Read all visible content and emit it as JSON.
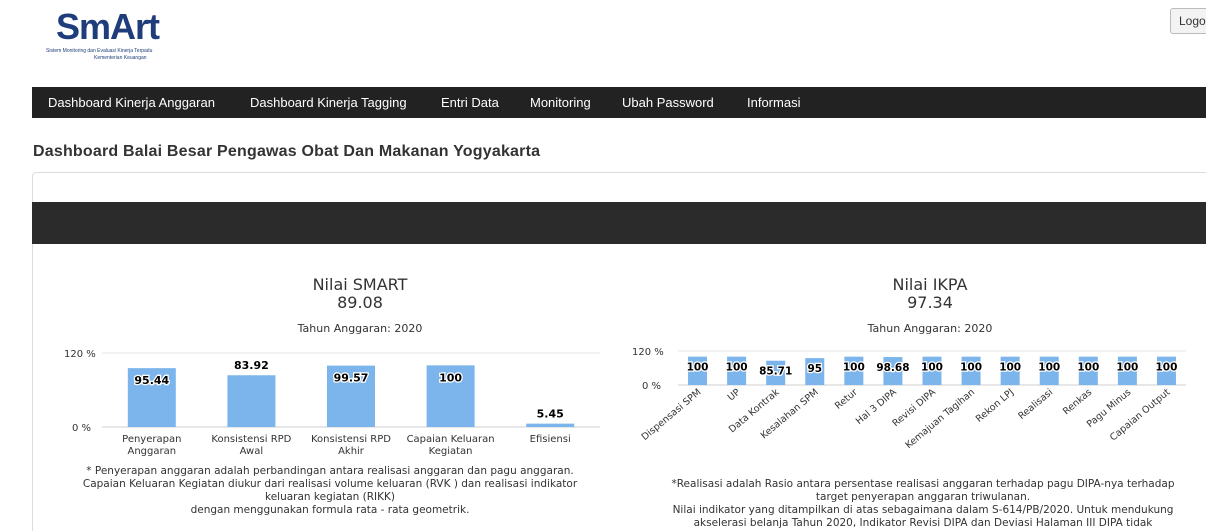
{
  "header": {
    "logo_text": "SmArt",
    "logo_tagline_1": "Sistem Monitoring dan Evaluasi Kinerja Terpadu",
    "logo_tagline_2": "Kementerian Keuangan",
    "logout_label": "Logo"
  },
  "nav": {
    "items": [
      "Dashboard Kinerja Anggaran",
      "Dashboard Kinerja Tagging",
      "Entri Data",
      "Monitoring",
      "Ubah Password",
      "Informasi"
    ]
  },
  "page_title": "Dashboard Balai Besar Pengawas Obat Dan Makanan Yogyakarta",
  "colors": {
    "bar": "#7cb5ec",
    "navbar": "#222222",
    "band": "#2b2b2b"
  },
  "chart_data": [
    {
      "type": "bar",
      "title": "Nilai SMART",
      "score": "89.08",
      "subtitle": "Tahun Anggaran: 2020",
      "categories": [
        [
          "Penyerapan",
          "Anggaran"
        ],
        [
          "Konsistensi RPD",
          "Awal"
        ],
        [
          "Konsistensi RPD",
          "Akhir"
        ],
        [
          "Capaian Keluaran",
          "Kegiatan"
        ],
        [
          "Efisiensi"
        ]
      ],
      "values": [
        95.44,
        83.92,
        99.57,
        100,
        5.45
      ],
      "value_labels": [
        "95.44",
        "83.92",
        "99.57",
        "100",
        "5.45"
      ],
      "y_ticks": [
        "120 %",
        "0 %"
      ],
      "ylim": [
        0,
        120
      ],
      "grid": true,
      "footnote": [
        "* Penyerapan anggaran adalah perbandingan antara realisasi anggaran dan pagu anggaran.",
        "Capaian Keluaran Kegiatan diukur dari realisasi volume keluaran (RVK ) dan realisasi indikator",
        "keluaran kegiatan (RIKK)",
        "dengan menggunakan formula rata - rata geometrik."
      ]
    },
    {
      "type": "bar",
      "title": "Nilai IKPA",
      "score": "97.34",
      "subtitle": "Tahun Anggaran: 2020",
      "categories": [
        "Dispensasi SPM",
        "UP",
        "Data Kontrak",
        "Kesalahan SPM",
        "Retur",
        "Hal 3 DIPA",
        "Revisi DIPA",
        "Kemajuan Tagihan",
        "Rekon LPJ",
        "Realisasi",
        "Renkas",
        "Pagu Minus",
        "Capaian Output"
      ],
      "values": [
        100,
        100,
        85.71,
        95,
        100,
        98.68,
        100,
        100,
        100,
        100,
        100,
        100,
        100
      ],
      "value_labels": [
        "100",
        "100",
        "85.71",
        "95",
        "100",
        "98.68",
        "100",
        "100",
        "100",
        "100",
        "100",
        "100",
        "100"
      ],
      "y_ticks": [
        "120 %",
        "0 %"
      ],
      "ylim": [
        0,
        120
      ],
      "grid": true,
      "footnote": [
        "*Realisasi adalah Rasio antara persentase realisasi anggaran terhadap pagu DIPA-nya terhadap",
        "target penyerapan anggaran triwulanan.",
        "Nilai indikator yang ditampilkan di atas sebagaimana dalam S-614/PB/2020. Untuk mendukung",
        "akselerasi belanja Tahun 2020, Indikator Revisi DIPA dan Deviasi Halaman III DIPA tidak"
      ]
    }
  ]
}
